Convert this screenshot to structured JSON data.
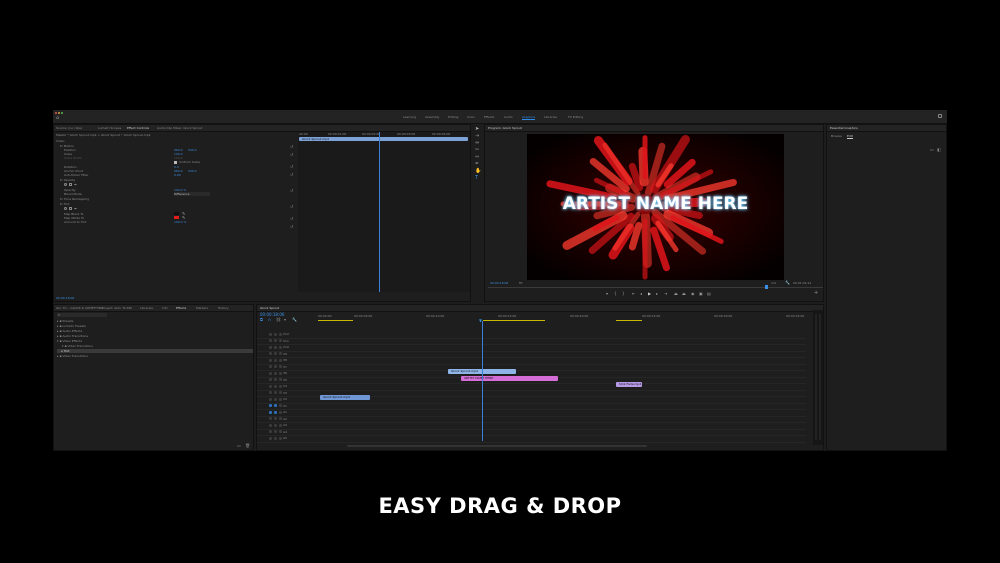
{
  "workspaces": [
    "Learning",
    "Assembly",
    "Editing",
    "Color",
    "Effects",
    "Audio",
    "Graphics",
    "Libraries",
    "FX Editing"
  ],
  "active_workspace": "Graphics",
  "source_panel": {
    "tabs": [
      "Source: (no clips)",
      "Lumetri Scopes",
      "Effect Controls",
      "Audio Clip Mixer: Glock Sprout"
    ],
    "active_tab": "Effect Controls",
    "header": "Master * Glock Sprout.mp4  >  Glock Sprout * Glock Sprout.mp4",
    "clip_name": "Glock Sprout.mp4",
    "ruler": [
      "00:00",
      "00:00:01:00",
      "00:00:02:00",
      "00:00:03:00",
      "00:00:04:00"
    ],
    "rows": [
      {
        "label": "Video",
        "values": []
      },
      {
        "label": "fx  Motion",
        "values": []
      },
      {
        "label": "Position",
        "values": [
          "960.0",
          "540.0"
        ]
      },
      {
        "label": "Scale",
        "values": [
          "100.0"
        ]
      },
      {
        "label": "Scale Width",
        "values": [
          "100.0"
        ]
      },
      {
        "label": "",
        "values": [
          "Uniform Scale"
        ]
      },
      {
        "label": "Rotation",
        "values": [
          "0.0"
        ]
      },
      {
        "label": "Anchor Point",
        "values": [
          "960.0",
          "540.0"
        ]
      },
      {
        "label": "Anti-flicker Filter",
        "values": [
          "0.00"
        ]
      },
      {
        "label": "fx  Opacity",
        "values": []
      },
      {
        "label": "",
        "values": []
      },
      {
        "label": "Opacity",
        "values": [
          "100.0 %"
        ]
      },
      {
        "label": "Blend Mode",
        "values": [
          "Difference"
        ]
      },
      {
        "label": "fx  Time Remapping",
        "values": []
      },
      {
        "label": "fx  Tint",
        "values": []
      },
      {
        "label": "",
        "values": []
      },
      {
        "label": "Map Black To",
        "values": []
      },
      {
        "label": "Map White To",
        "values": []
      },
      {
        "label": "Amount to Tint",
        "values": [
          "100.0 %"
        ]
      }
    ],
    "timecode": "00:00:18:06"
  },
  "program_monitor": {
    "title": "Program: Glock Sprout",
    "overlay_text": "ARTIST NAME HERE",
    "timecode": "00:00:18:06",
    "fit": "Fit",
    "quality": "1/4",
    "duration": "00:01:04:12"
  },
  "essential_graphics": {
    "title": "Essential Graphics",
    "tabs": [
      "Browse",
      "Edit"
    ],
    "active_tab": "Edit"
  },
  "project_panel": {
    "tabs": [
      "Glo. TC... GLOCK & SOMETHING",
      "Project: GLO. TC.EDI",
      "Libraries",
      "Info",
      "Effects",
      "Markers",
      "History"
    ],
    "active_tab": "Effects",
    "items": [
      "Presets",
      "Lumetri Presets",
      "Audio Effects",
      "Audio Transitions",
      "Video Effects",
      "Video Transitions",
      "Tint",
      "Video Transitions"
    ]
  },
  "timeline": {
    "title": "Glock Sprout",
    "timecode": "00:00:18:06",
    "ruler": [
      "00:00:00",
      "00:00:05:00",
      "00:00:10:00",
      "00:00:15:00",
      "00:00:20:00",
      "00:00:25:00",
      "00:00:30:00",
      "00:00:35:00"
    ],
    "tracks": [
      "V12",
      "V11",
      "V10",
      "V9",
      "V8",
      "V7",
      "V6",
      "V5",
      "V4",
      "V3",
      "V2",
      "V1",
      "A1",
      "A2",
      "A3",
      "A4",
      "A5"
    ],
    "clips": [
      {
        "label": "Glock Sprout.mp4",
        "color": "#8fb4e8"
      },
      {
        "label": "ARTIST NAME HERE",
        "color": "#d46ed6"
      },
      {
        "label": "Smk Fade.mp4",
        "color": "#b79ae6"
      },
      {
        "label": "Glock Sprout.mp4",
        "color": "#6f97d6"
      }
    ]
  },
  "caption": "EASY DRAG & DROP"
}
